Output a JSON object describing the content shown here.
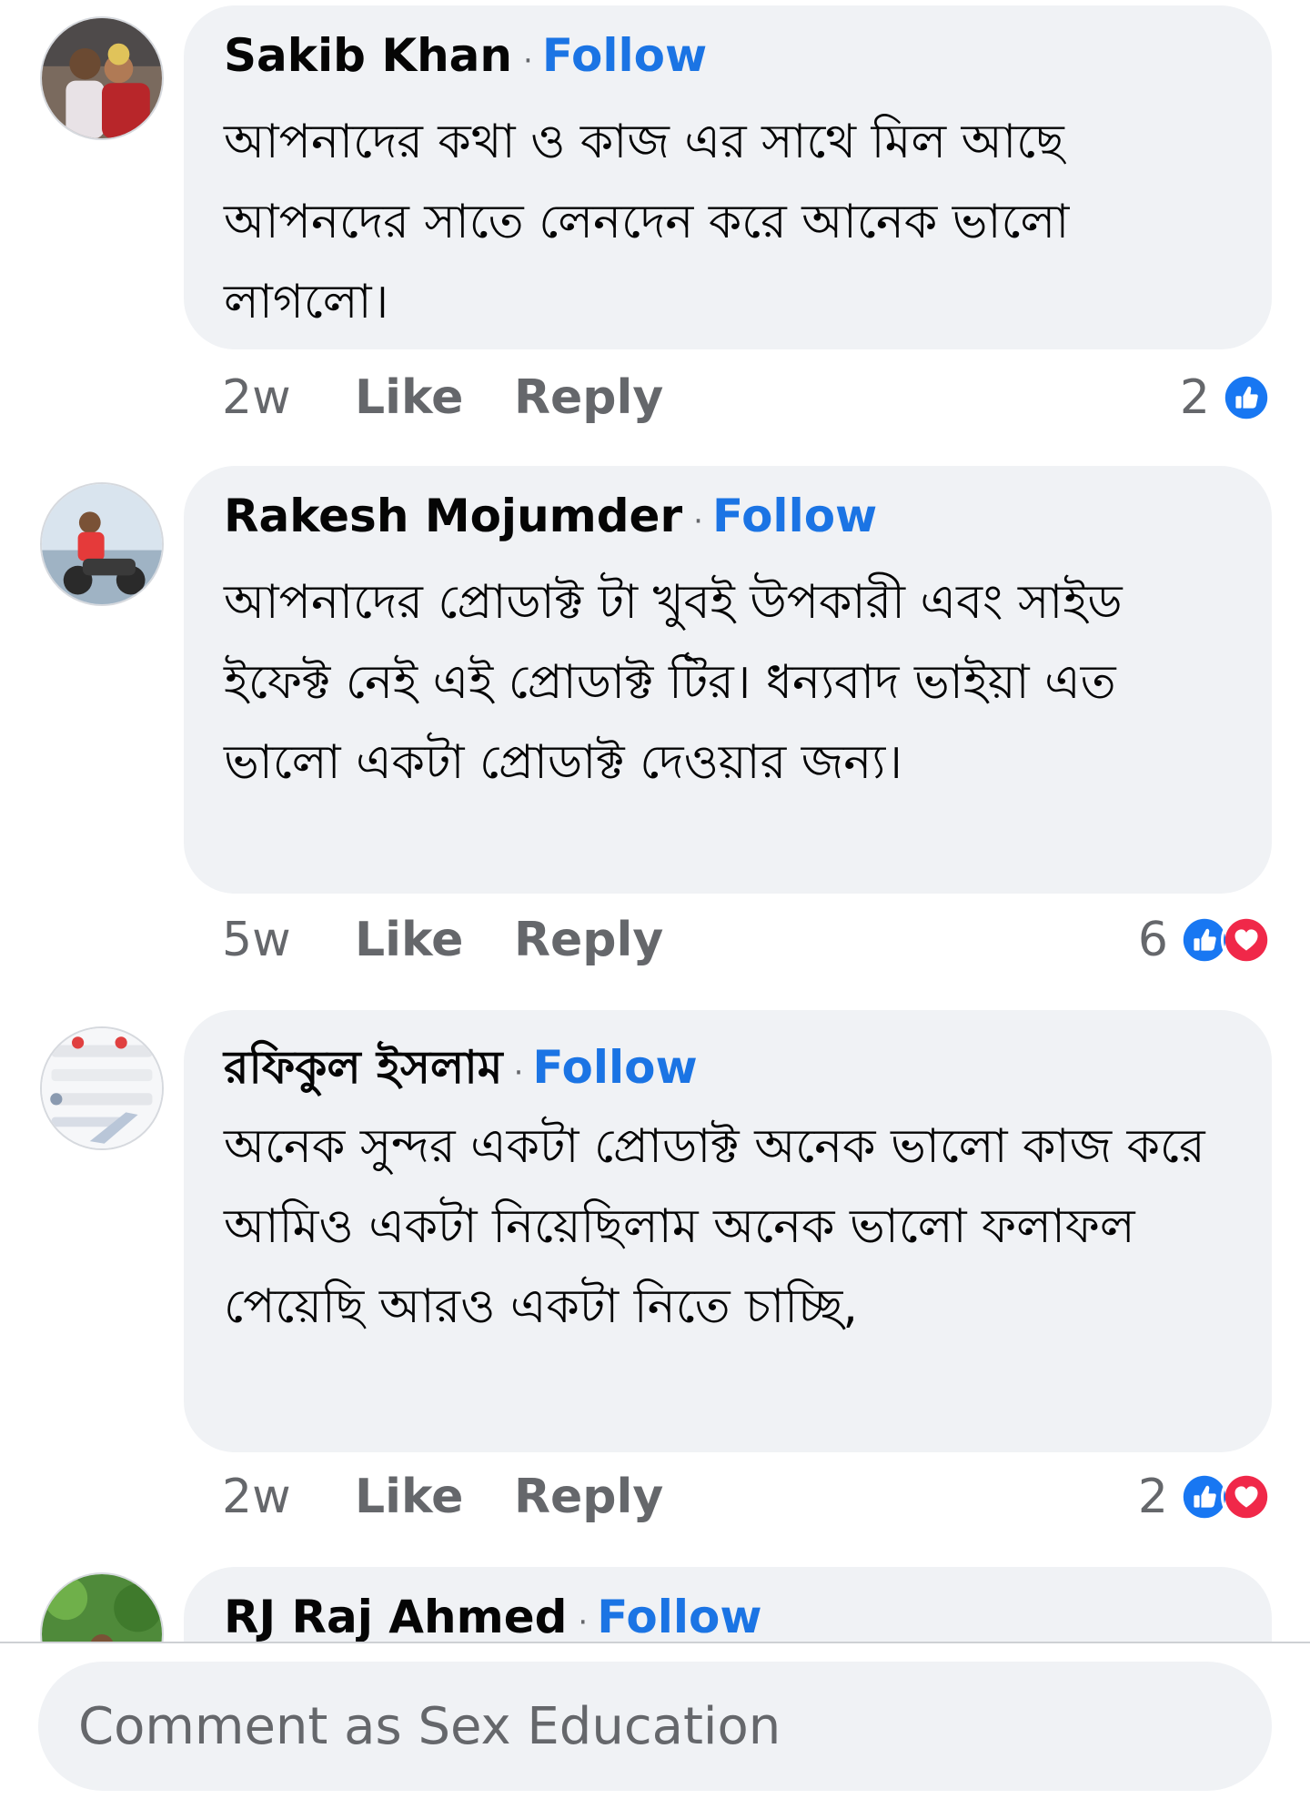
{
  "follow_label": "Follow",
  "separator": "·",
  "actions": {
    "like": "Like",
    "reply": "Reply"
  },
  "colors": {
    "accent": "#1b74e4",
    "like_blue": "#1877f2",
    "love_red": "#f02849",
    "bubble": "#f0f2f5",
    "secondary_text": "#65676b"
  },
  "comments": [
    {
      "author": "Sakib Khan",
      "text": "আপনাদের কথা ও কাজ এর সাথে মিল আছে আপনদের সাতে লেনদেন করে আনেক ভালো লাগলো।",
      "age": "2w",
      "reaction_count": "2",
      "reactions": [
        "like-icon"
      ]
    },
    {
      "author": "Rakesh Mojumder",
      "text": "আপনাদের প্রোডাক্ট টা খুবই উপকারী এবং সাইড ইফেক্ট নেই এই প্রোডাক্ট টির। ধন্যবাদ ভাইয়া এত ভালো একটা প্রোডাক্ট দেওয়ার জন্য।",
      "age": "5w",
      "reaction_count": "6",
      "reactions": [
        "like-icon",
        "love-icon"
      ]
    },
    {
      "author": "রফিকুল ইসলাম",
      "text": "অনেক সুন্দর একটা প্রোডাক্ট অনেক ভালো কাজ করে আমিও একটা নিয়েছিলাম অনেক ভালো ফলাফল পেয়েছি আরও একটা নিতে চাচ্ছি,",
      "age": "2w",
      "reaction_count": "2",
      "reactions": [
        "like-icon",
        "love-icon"
      ]
    },
    {
      "author": "RJ Raj Ahmed"
    }
  ],
  "composer": {
    "placeholder": "Comment as Sex Education"
  }
}
